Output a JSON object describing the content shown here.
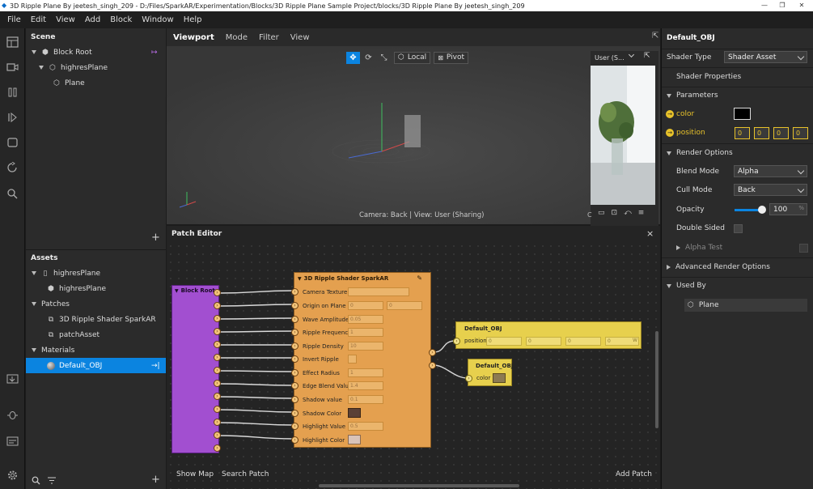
{
  "window": {
    "title": "3D Ripple Plane By jeetesh_singh_209 - D:/Files/SparkAR/Experimentation/Blocks/3D Ripple Plane Sample Project/blocks/3D Ripple Plane By jeetesh_singh_209"
  },
  "menu": [
    "File",
    "Edit",
    "View",
    "Add",
    "Block",
    "Window",
    "Help"
  ],
  "scene": {
    "title": "Scene",
    "items": [
      {
        "label": "Block Root",
        "level": 0
      },
      {
        "label": "highresPlane",
        "level": 1
      },
      {
        "label": "Plane",
        "level": 2
      }
    ],
    "add_label": "+"
  },
  "assets": {
    "title": "Assets",
    "items": [
      {
        "label": "highresPlane",
        "level": 0,
        "icon": "file-icon",
        "expand": true
      },
      {
        "label": "highresPlane",
        "level": 1,
        "icon": "cube-icon"
      },
      {
        "label": "Patches",
        "level": 0,
        "icon": "",
        "expand": true
      },
      {
        "label": "3D Ripple Shader SparkAR",
        "level": 1,
        "icon": "patch-icon"
      },
      {
        "label": "patchAsset",
        "level": 1,
        "icon": "patch-icon"
      },
      {
        "label": "Materials",
        "level": 0,
        "icon": "",
        "expand": true
      },
      {
        "label": "Default_OBJ",
        "level": 1,
        "icon": "material-icon",
        "selected": true
      }
    ],
    "add_label": "+"
  },
  "viewport": {
    "tabs": [
      "Viewport",
      "Mode",
      "Filter",
      "View"
    ],
    "local_label": "Local",
    "pivot_label": "Pivot",
    "camera_status": "Camera: Back | View: User (Sharing)",
    "preview_select": "User (S...",
    "preview_corner": "C"
  },
  "patch_editor": {
    "title": "Patch Editor",
    "close": "×",
    "block_root": "Block Root",
    "shader_node": {
      "title": "3D Ripple Shader SparkAR",
      "rows": [
        {
          "label": "Camera Texture",
          "value": ""
        },
        {
          "label": "Origin on Plane",
          "value": "0",
          "value2": "0"
        },
        {
          "label": "Wave Amplitude",
          "value": "0.05"
        },
        {
          "label": "Ripple Frequency",
          "value": "1"
        },
        {
          "label": "Ripple Density",
          "value": "10"
        },
        {
          "label": "Invert Ripple",
          "value": ""
        },
        {
          "label": "Effect Radius",
          "value": "1"
        },
        {
          "label": "Edge Blend Value",
          "value": "1.4"
        },
        {
          "label": "Shadow value",
          "value": "0.1"
        },
        {
          "label": "Shadow Color",
          "value": ""
        },
        {
          "label": "Highlight Value",
          "value": "0.5"
        },
        {
          "label": "Highlight Color",
          "value": ""
        }
      ]
    },
    "obj_node_1": {
      "title": "Default_OBJ",
      "port": "position",
      "values": [
        "0",
        "0",
        "0",
        "0"
      ],
      "last_suffix": "W"
    },
    "obj_node_2": {
      "title": "Default_OBJ",
      "port": "color"
    },
    "show_map": "Show Map",
    "search_patch": "Search Patch",
    "add_patch": "Add Patch"
  },
  "inspector": {
    "title": "Default_OBJ",
    "shader_type_label": "Shader Type",
    "shader_type_value": "Shader Asset",
    "shader_properties": "Shader Properties",
    "parameters": "Parameters",
    "color_label": "color",
    "position_label": "position",
    "position_values": [
      "0",
      "0",
      "0",
      "0"
    ],
    "render_options": "Render Options",
    "blend_mode_label": "Blend Mode",
    "blend_mode_value": "Alpha",
    "cull_mode_label": "Cull Mode",
    "cull_mode_value": "Back",
    "opacity_label": "Opacity",
    "opacity_value": "100",
    "opacity_unit": "%",
    "opacity_fraction": 1.0,
    "double_sided_label": "Double Sided",
    "alpha_test_label": "Alpha Test",
    "advanced_render": "Advanced Render Options",
    "used_by": "Used By",
    "used_by_item": "Plane"
  },
  "colors": {
    "accent": "#0b84e0",
    "patch_orange": "#e4a04f",
    "block_purple": "#a24fd0",
    "material_yellow": "#e7d04d",
    "param_yellow": "#e8c22a"
  }
}
